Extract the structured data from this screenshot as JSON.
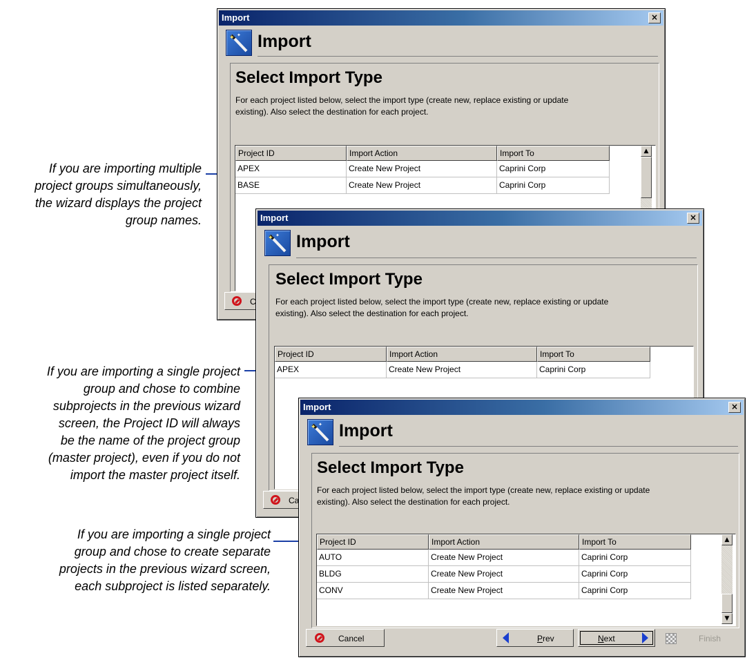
{
  "callouts": [
    {
      "lines": [
        "If you are importing multiple",
        "project groups simultaneously,",
        "the wizard displays the project",
        "group names."
      ]
    },
    {
      "lines": [
        "If you are importing a single project",
        "group and chose to combine",
        "subprojects in the previous wizard",
        "screen, the Project ID will always",
        "be the name of the project group",
        "(master project), even if you do not",
        "import the master project itself."
      ]
    },
    {
      "lines": [
        "If you are importing a single project",
        "group and chose to create separate",
        "projects in the previous wizard screen,",
        "each subproject is listed separately."
      ]
    }
  ],
  "dialog": {
    "window_title": "Import",
    "header_title": "Import",
    "close_glyph": "×",
    "section_title": "Select Import Type",
    "description_line1": "For each project listed below, select the import type (create new, replace existing or update",
    "description_line2": "existing).  Also select the destination for each project.",
    "columns": [
      "Project ID",
      "Import Action",
      "Import To"
    ]
  },
  "windows": [
    {
      "rows": [
        {
          "project_id": "APEX",
          "action": "Create New Project",
          "import_to": "Caprini Corp"
        },
        {
          "project_id": "BASE",
          "action": "Create New Project",
          "import_to": "Caprini Corp"
        }
      ]
    },
    {
      "rows": [
        {
          "project_id": "APEX",
          "action": "Create New Project",
          "import_to": "Caprini Corp"
        }
      ]
    },
    {
      "rows": [
        {
          "project_id": "AUTO",
          "action": "Create New Project",
          "import_to": "Caprini Corp"
        },
        {
          "project_id": "BLDG",
          "action": "Create New Project",
          "import_to": "Caprini Corp"
        },
        {
          "project_id": "CONV",
          "action": "Create New Project",
          "import_to": "Caprini Corp"
        }
      ]
    }
  ],
  "buttons": {
    "cancel": "Cancel",
    "prev_mnemonic": "P",
    "prev_rest": "rev",
    "next_mnemonic": "N",
    "next_rest": "ext",
    "finish": "Finish"
  },
  "icons": {
    "wizard": "magic-wand-icon",
    "cancel": "cancel-icon",
    "prev": "left-arrow-icon",
    "next": "right-arrow-icon",
    "finish": "checkered-flag-icon",
    "scroll_up": "▲",
    "scroll_down": "▼"
  },
  "colors": {
    "dialog_face": "#d4d0c8",
    "titlebar_start": "#0a246a",
    "titlebar_end": "#a6caf0",
    "callout_leader": "#1a3fa6",
    "arrow_blue": "#1a3fcf",
    "cancel_red": "#d0141c"
  }
}
